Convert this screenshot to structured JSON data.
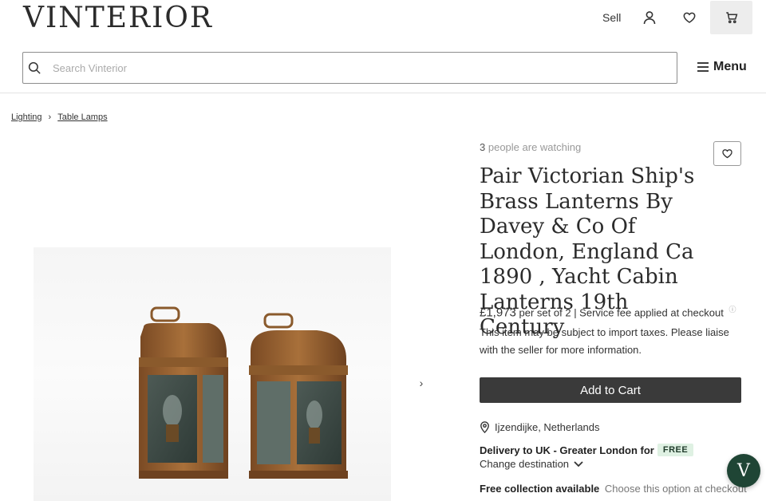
{
  "header": {
    "logo": "VINTERIOR",
    "sell_label": "Sell",
    "account_icon": "person-icon",
    "favourites_icon": "heart-icon",
    "cart_icon": "cart-icon"
  },
  "search": {
    "placeholder": "Search Vinterior",
    "value": "",
    "menu_label": "Menu"
  },
  "breadcrumb": [
    {
      "label": "Lighting"
    },
    {
      "label": "Table Lamps"
    }
  ],
  "product": {
    "watching_count": "3",
    "watching_text": "people are watching",
    "title": "Pair Victorian Ship's Brass Lanterns By Davey & Co Of London, England Ca 1890 , Yacht Cabin Lanterns 19th Century",
    "price": "£1,973",
    "price_suffix": "per set of 2",
    "service_fee": "| Service fee applied at checkout",
    "tax_note": "This item may be subject to import taxes. Please liaise with the seller for more information.",
    "add_to_cart": "Add to Cart",
    "location": "Ijzendijke, Netherlands",
    "delivery_label": "Delivery to UK - Greater London for",
    "delivery_badge": "FREE",
    "change_destination": "Change destination",
    "collection_label": "Free collection available",
    "collection_note": "Choose this option at checkout"
  },
  "chat": {
    "label": "V"
  },
  "colors": {
    "button_dark": "#3a3a3a",
    "free_badge_bg": "#dff1e3",
    "chat_green": "#1f4535"
  }
}
